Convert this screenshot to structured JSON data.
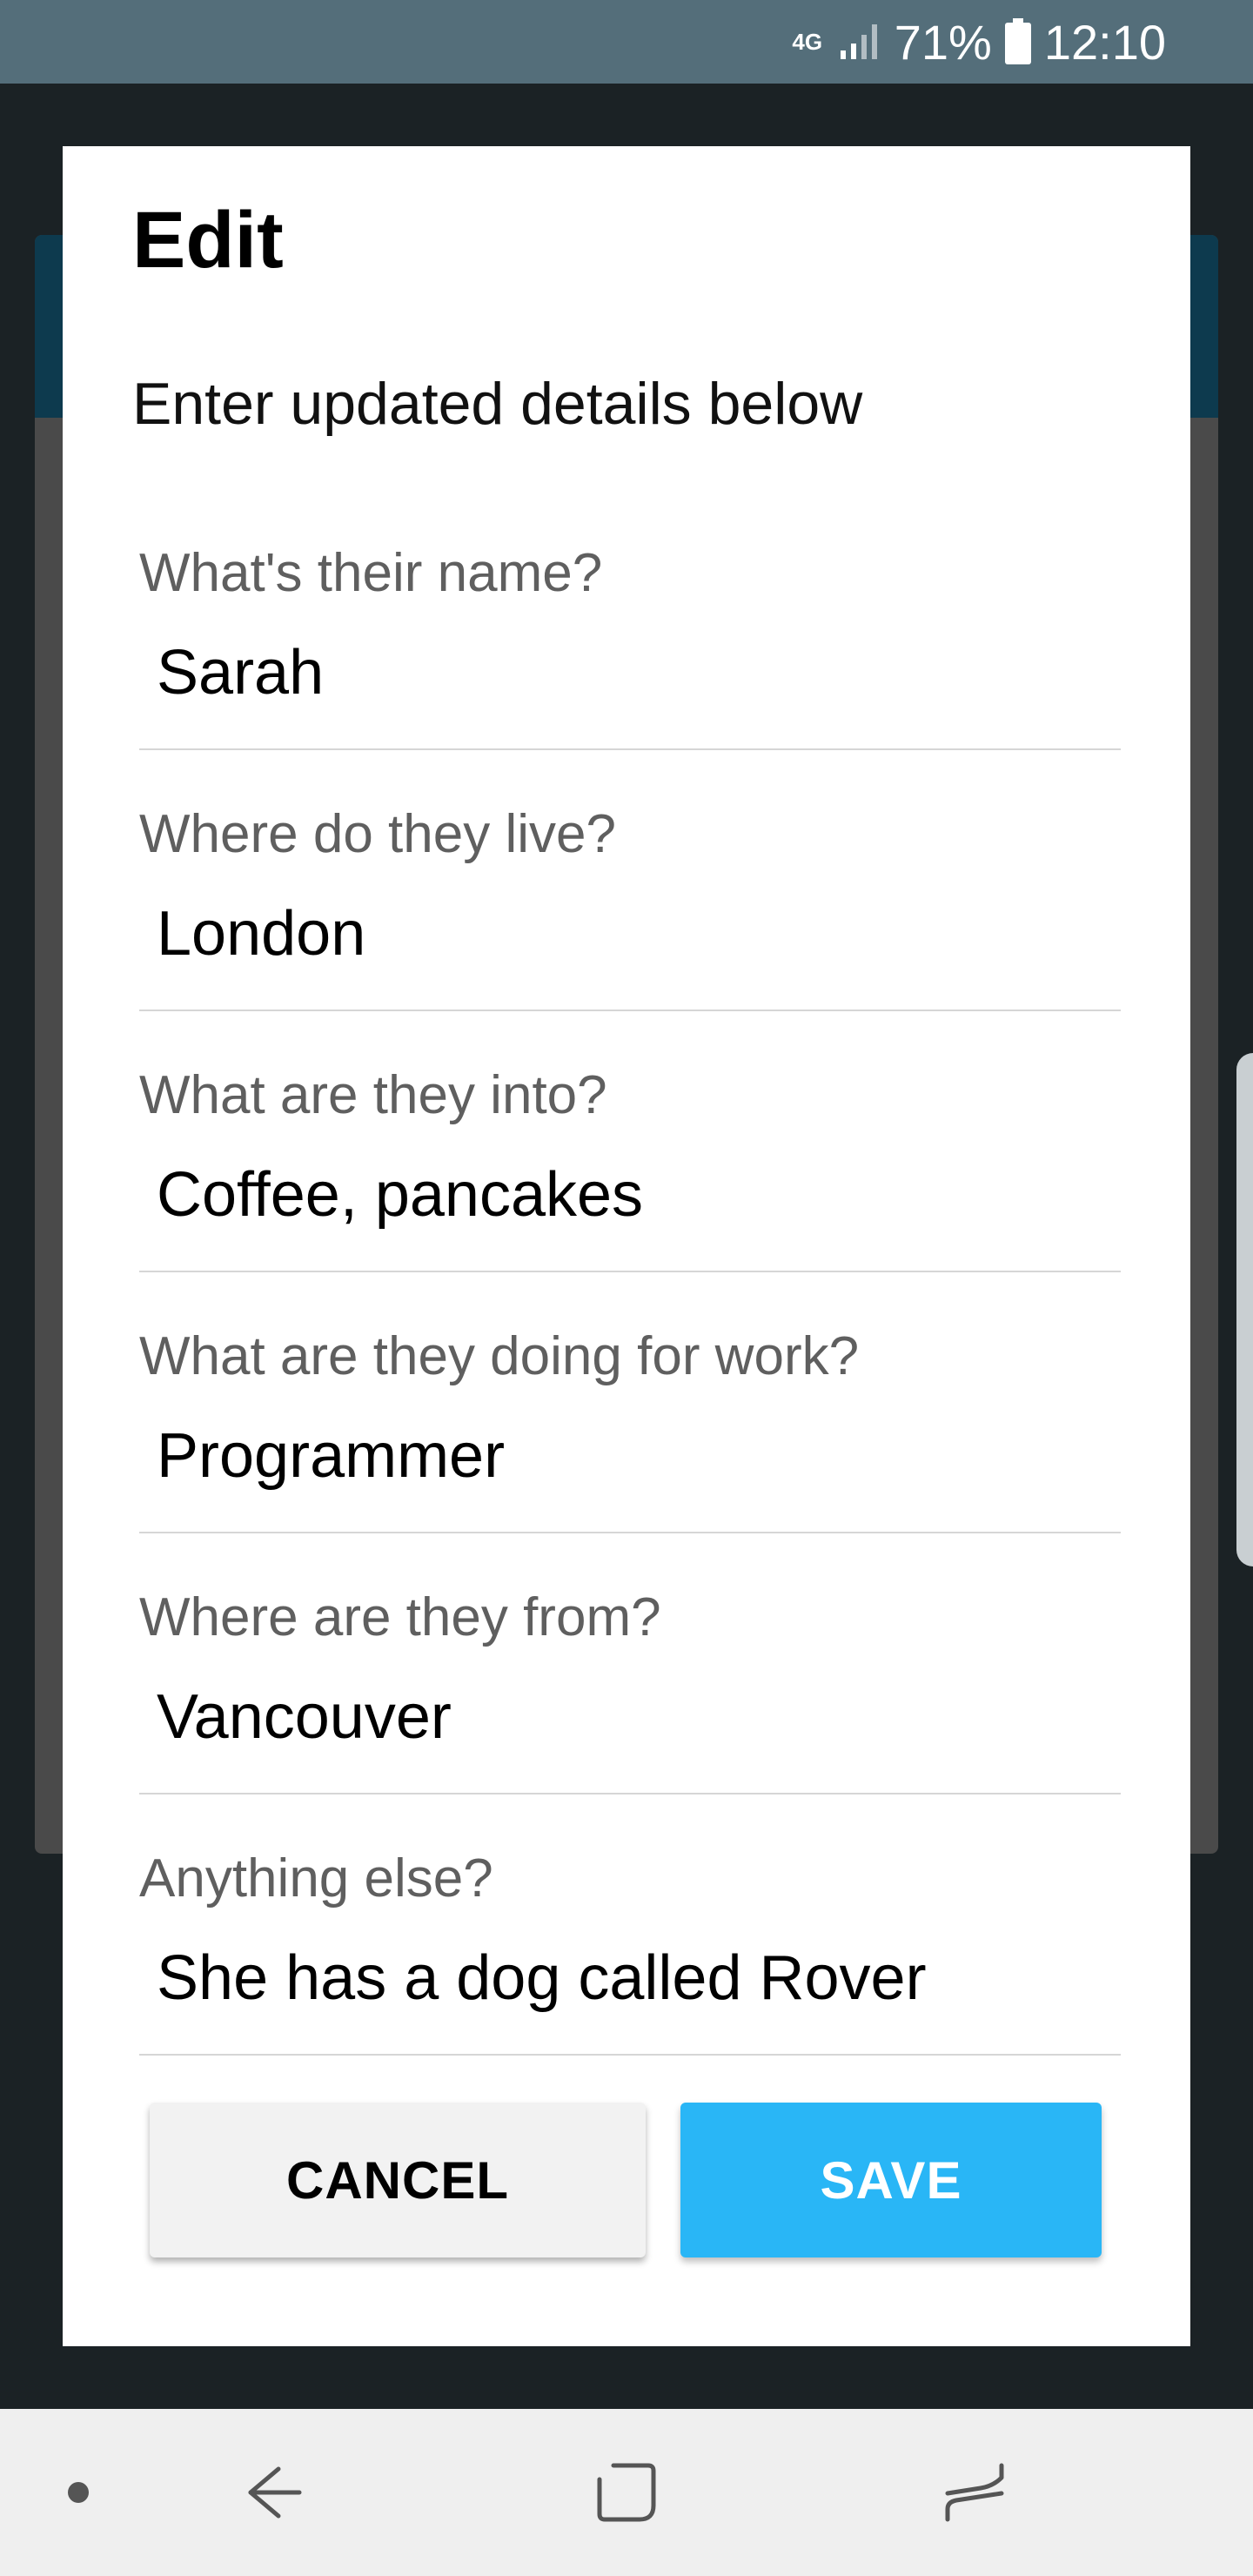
{
  "status_bar": {
    "network_type": "4G",
    "battery_percent": "71%",
    "time": "12:10",
    "icons": [
      "signal-icon",
      "battery-icon"
    ]
  },
  "dialog": {
    "title": "Edit",
    "subtitle": "Enter updated details below",
    "fields": [
      {
        "label": "What's their name?",
        "value": "Sarah"
      },
      {
        "label": "Where do they live?",
        "value": "London"
      },
      {
        "label": "What are they into?",
        "value": "Coffee, pancakes"
      },
      {
        "label": "What are they doing for work?",
        "value": "Programmer"
      },
      {
        "label": "Where are they from?",
        "value": "Vancouver"
      },
      {
        "label": "Anything else?",
        "value": "She has a dog called Rover"
      }
    ],
    "cancel_label": "CANCEL",
    "save_label": "SAVE"
  },
  "nav_bar": {
    "icons": [
      "dot-icon",
      "back-icon",
      "home-icon",
      "recents-icon"
    ]
  },
  "colors": {
    "status_bar": "#546e7a",
    "accent": "#29b6f6",
    "scrim": "#1b2225"
  }
}
